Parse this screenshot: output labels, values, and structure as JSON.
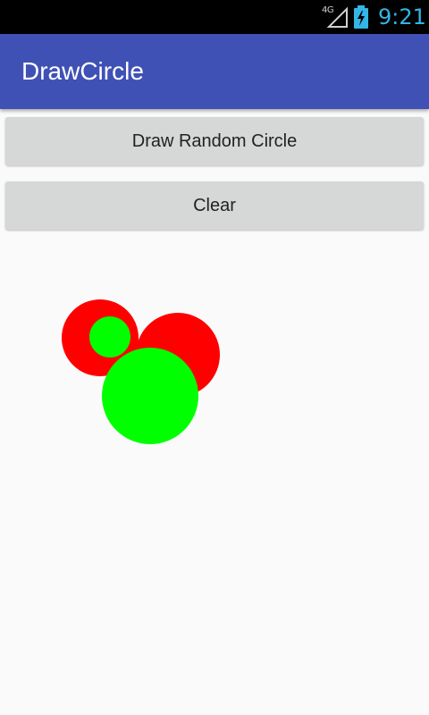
{
  "status_bar": {
    "network_label": "4G",
    "time": "9:21",
    "icons": [
      "signal-icon",
      "battery-charging-icon"
    ],
    "accent_color": "#33b5e5"
  },
  "app_bar": {
    "title": "DrawCircle",
    "color": "#3f51b5"
  },
  "buttons": {
    "draw_label": "Draw Random Circle",
    "clear_label": "Clear"
  },
  "canvas": {
    "circle_colors": {
      "red": "#ff0000",
      "green": "#00ff00"
    },
    "circle_count": 4
  }
}
